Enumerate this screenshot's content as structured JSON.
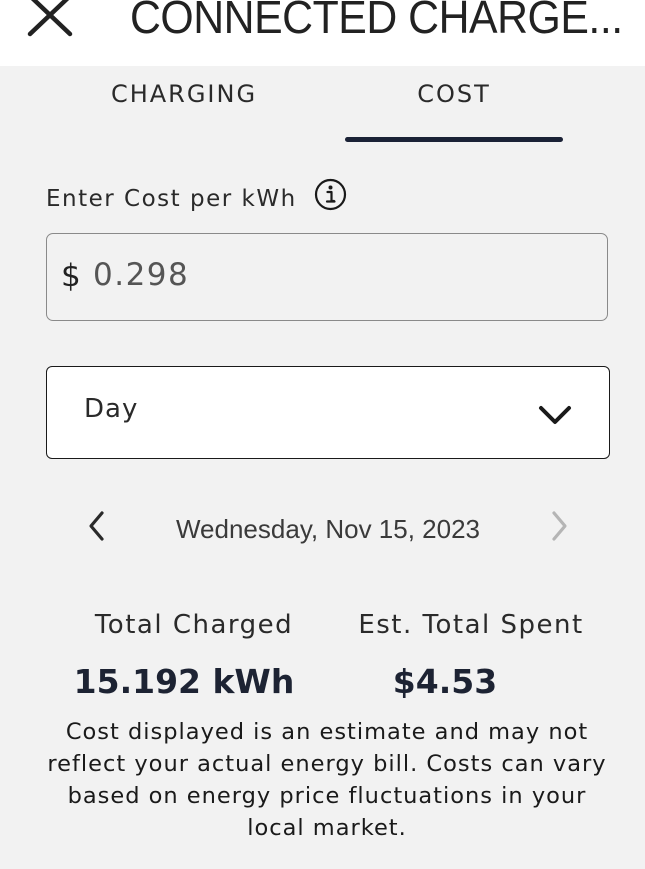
{
  "header": {
    "title": "CONNECTED CHARGE...",
    "close_icon": "close-icon"
  },
  "tabs": [
    {
      "label": "CHARGING",
      "selected": false
    },
    {
      "label": "COST",
      "selected": true
    }
  ],
  "cost_input": {
    "label": "Enter Cost per kWh",
    "info_icon": "info-icon",
    "currency_symbol": "$",
    "value": "0.298"
  },
  "period_select": {
    "selected": "Day",
    "icon": "chevron-down-icon"
  },
  "date_nav": {
    "date": "Wednesday, Nov 15, 2023",
    "prev_icon": "chevron-left-icon",
    "next_icon": "chevron-right-icon",
    "next_enabled": false
  },
  "stats": {
    "total_charged_label": "Total Charged",
    "total_charged_value": "15.192 kWh",
    "total_spent_label": "Est. Total Spent",
    "total_spent_value": "$4.53"
  },
  "disclaimer": "Cost displayed is an estimate and may not reflect your actual energy bill. Costs can vary based on energy price fluctuations in your local market.",
  "colors": {
    "background": "#f2f2f2",
    "header_bg": "#ffffff",
    "accent": "#1b2236",
    "disabled": "#b0b0b0"
  }
}
